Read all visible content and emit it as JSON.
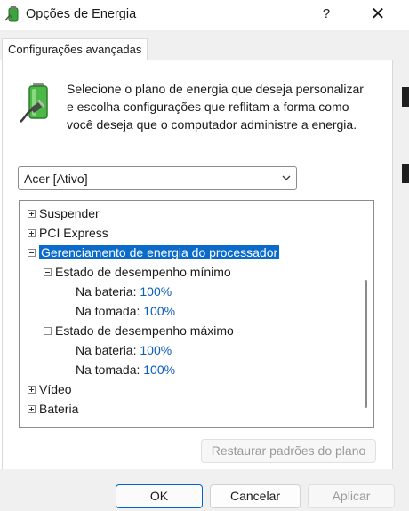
{
  "window": {
    "title": "Opções de Energia",
    "help_label": "?",
    "close_label": "✕"
  },
  "tabs": [
    {
      "label": "Configurações avançadas"
    }
  ],
  "description": "Selecione o plano de energia que deseja personalizar e escolha configurações que reflitam a forma como você deseja que o computador administre a energia.",
  "plan_select": {
    "value": "Acer [Ativo]"
  },
  "tree": {
    "suspender": "Suspender",
    "pci_express": "PCI Express",
    "processor_power": "Gerenciamento de energia do processador",
    "min_state": {
      "label": "Estado de desempenho mínimo",
      "battery_label": "Na bateria:",
      "battery_value": "100%",
      "plugged_label": "Na tomada:",
      "plugged_value": "100%"
    },
    "max_state": {
      "label": "Estado de desempenho máximo",
      "battery_label": "Na bateria:",
      "battery_value": "100%",
      "plugged_label": "Na tomada:",
      "plugged_value": "100%"
    },
    "video": "Vídeo",
    "bateria": "Bateria"
  },
  "buttons": {
    "restore": "Restaurar padrões do plano",
    "ok": "OK",
    "cancel": "Cancelar",
    "apply": "Aplicar"
  },
  "icons": {
    "app": "power-options-battery-icon",
    "battery": "battery-plug-icon",
    "dropdown": "chevron-down-icon",
    "expand": "plus-box-icon",
    "collapse": "minus-box-icon"
  },
  "colors": {
    "selection": "#0b6bcb",
    "value_text": "#0a5cbf",
    "primary_border": "#0067c0"
  }
}
